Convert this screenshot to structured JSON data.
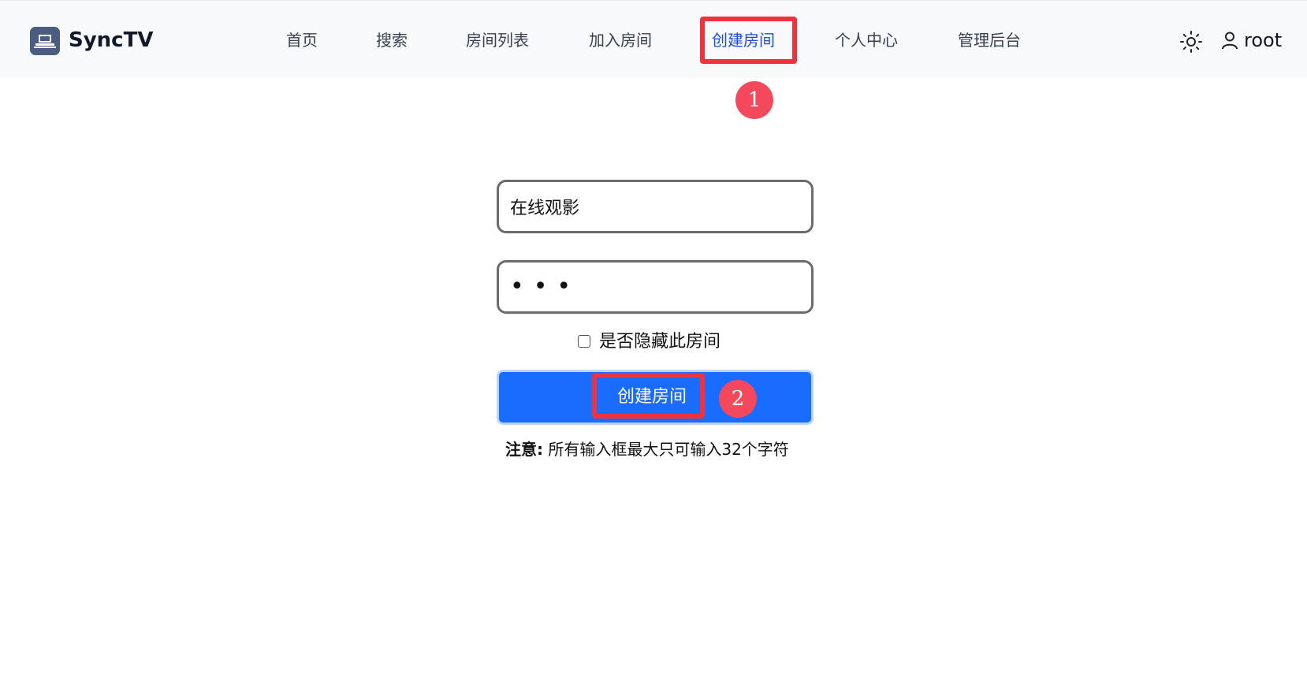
{
  "app": {
    "brand": "SyncTV"
  },
  "nav": {
    "items": [
      {
        "label": "首页"
      },
      {
        "label": "搜索"
      },
      {
        "label": "房间列表"
      },
      {
        "label": "加入房间"
      },
      {
        "label": "创建房间",
        "active": true
      },
      {
        "label": "个人中心"
      },
      {
        "label": "管理后台"
      }
    ]
  },
  "user": {
    "name": "root"
  },
  "form": {
    "room_name_value": "在线观影",
    "password_value": "•••",
    "hide_label": "是否隐藏此房间",
    "submit_label": "创建房间",
    "note_title": "注意:",
    "note_text": "所有输入框最大只可输入32个字符"
  },
  "markers": [
    "1",
    "2"
  ],
  "colors": {
    "accent": "#1a6cff",
    "highlight": "#f0313e",
    "marker": "#f4495c"
  }
}
